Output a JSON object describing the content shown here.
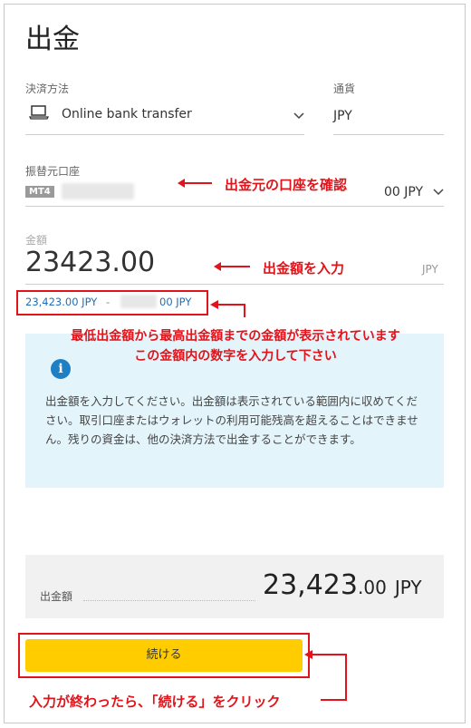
{
  "page": {
    "title": "出金"
  },
  "payment": {
    "method_label": "決済方法",
    "method_value": "Online bank transfer",
    "currency_label": "通貨",
    "currency_value": "JPY"
  },
  "source_account": {
    "label": "振替元口座",
    "badge": "MT4",
    "balance_suffix": "00 JPY"
  },
  "amount": {
    "label": "金額",
    "value": "23423.00",
    "unit": "JPY",
    "range_min": "23,423.00 JPY",
    "range_sep": "-",
    "range_max_suffix": "00 JPY"
  },
  "info": {
    "text": "出金額を入力してください。出金額は表示されている範囲内に収めてください。取引口座またはウォレットの利用可能残高を超えることはできません。残りの資金は、他の決済方法で出金することができます。"
  },
  "summary": {
    "label": "出金額",
    "amount_main": "23,423",
    "amount_decimal": ".00",
    "currency": "JPY"
  },
  "continue_button": {
    "label": "続ける"
  },
  "annotations": {
    "confirm_account": "出金元の口座を確認",
    "enter_amount": "出金額を入力",
    "range_note_line1": "最低出金額から最高出金額までの金額が表示されています",
    "range_note_line2": "この金額内の数字を入力して下さい",
    "continue_note": "入力が終わったら、「続ける」をクリック"
  },
  "colors": {
    "annotation": "#e0141a",
    "button": "#ffcc00",
    "info_bg": "#e4f4fb",
    "link": "#1f6fb8"
  }
}
